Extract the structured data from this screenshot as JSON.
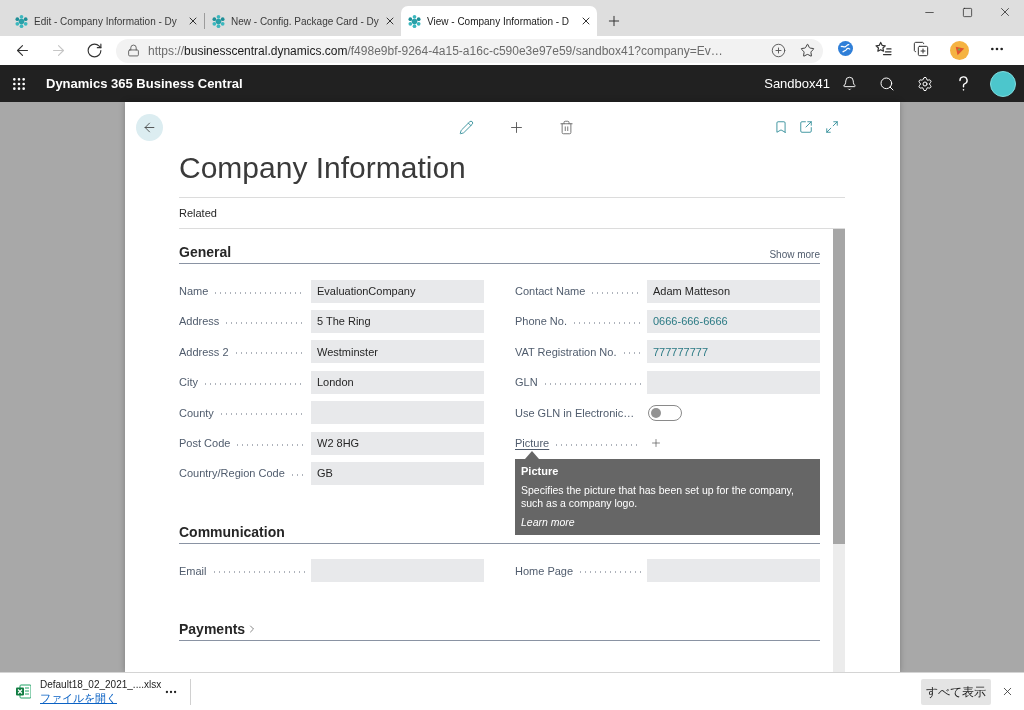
{
  "browser": {
    "tabs": [
      {
        "title": "Edit - Company Information - Dy",
        "selected": false
      },
      {
        "title": "New - Config. Package Card - Dy",
        "selected": false
      },
      {
        "title": "View - Company Information - D",
        "selected": true
      }
    ],
    "nav": [
      {
        "kind": "back",
        "disabled": false
      },
      {
        "kind": "forward",
        "disabled": true
      },
      {
        "kind": "refresh",
        "disabled": false
      }
    ],
    "address": {
      "scheme": "https://",
      "host": "businesscentral.dynamics.com",
      "path": "/f498e9bf-9264-4a15-a16c-c590e3e97e59/sandbox41?company=Ev…"
    }
  },
  "app_bar": {
    "title": "Dynamics 365 Business Central",
    "environment": "Sandbox41"
  },
  "page": {
    "title": "Company Information",
    "action_bar": "Related",
    "sections": [
      {
        "title": "General",
        "expanded": true,
        "show_more": "Show more",
        "columns": [
          [
            {
              "label": "Name",
              "kind": "text",
              "value": "EvaluationCompany"
            },
            {
              "label": "Address",
              "kind": "text",
              "value": "5 The Ring"
            },
            {
              "label": "Address 2",
              "kind": "text",
              "value": "Westminster"
            },
            {
              "label": "City",
              "kind": "text",
              "value": "London"
            },
            {
              "label": "County",
              "kind": "text"
            },
            {
              "label": "Post Code",
              "kind": "text",
              "value": "W2 8HG"
            },
            {
              "label": "Country/Region Code",
              "kind": "text",
              "value": "GB"
            }
          ],
          [
            {
              "label": "Contact Name",
              "kind": "text",
              "value": "Adam Matteson"
            },
            {
              "label": "Phone No.",
              "kind": "link",
              "value": "0666-666-6666"
            },
            {
              "label": "VAT Registration No.",
              "kind": "link",
              "value": "777777777"
            },
            {
              "label": "GLN",
              "kind": "text"
            },
            {
              "label": "Use GLN in Electronic…",
              "kind": "toggle",
              "on": false
            },
            {
              "label": "Picture",
              "kind": "picture",
              "tooltip": {
                "title": "Picture",
                "text": "Specifies the picture that has been set up for the company, such as a company logo.",
                "link": "Learn more"
              }
            }
          ]
        ]
      },
      {
        "title": "Communication",
        "expanded": true,
        "columns": [
          [
            {
              "label": "Email",
              "kind": "text"
            }
          ],
          [
            {
              "label": "Home Page",
              "kind": "text"
            }
          ]
        ]
      },
      {
        "title": "Payments",
        "expanded": false
      }
    ]
  },
  "download_bar": {
    "file": "Default18_02_2021_....xlsx",
    "open_link": "ファイルを開く",
    "show_all": "すべて表示"
  }
}
